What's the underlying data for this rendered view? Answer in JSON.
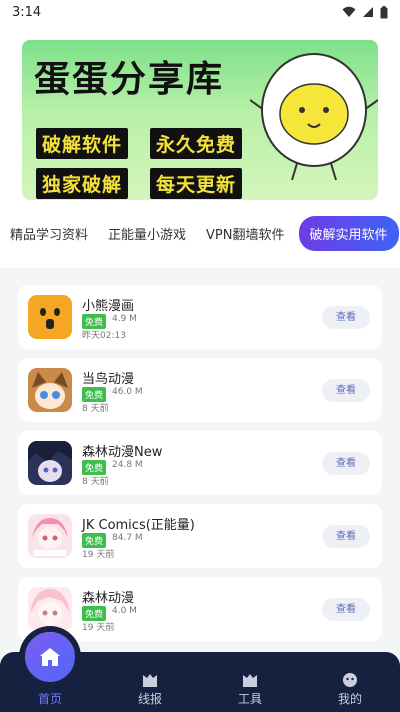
{
  "status_bar": {
    "time": "3:14"
  },
  "banner": {
    "title": "蛋蛋分享库",
    "tags": [
      "破解软件",
      "永久免费",
      "独家破解",
      "每天更新"
    ]
  },
  "tabs": [
    {
      "label": "精品学习资料"
    },
    {
      "label": "正能量小游戏"
    },
    {
      "label": "VPN翻墙软件"
    },
    {
      "label": "破解实用软件"
    }
  ],
  "apps": [
    {
      "name": "小熊漫画",
      "badge": "免费",
      "size": "4.9 M",
      "time": "昨天02:13",
      "action": "查看"
    },
    {
      "name": "当鸟动漫",
      "badge": "免费",
      "size": "46.0 M",
      "time": "8 天前",
      "action": "查看"
    },
    {
      "name": "森林动漫New",
      "badge": "免费",
      "size": "24.8 M",
      "time": "8 天前",
      "action": "查看"
    },
    {
      "name": "JK Comics(正能量)",
      "badge": "免费",
      "size": "84.7 M",
      "time": "19 天前",
      "action": "查看"
    },
    {
      "name": "森林动漫",
      "badge": "免费",
      "size": "4.0 M",
      "time": "19 天前",
      "action": "查看"
    }
  ],
  "nav": [
    {
      "label": "首页"
    },
    {
      "label": "线报"
    },
    {
      "label": "工具"
    },
    {
      "label": "我的"
    }
  ],
  "colors": {
    "accent": "#6d7cf7",
    "nav_bg": "#16213f",
    "free_badge": "#3ebf4d"
  }
}
